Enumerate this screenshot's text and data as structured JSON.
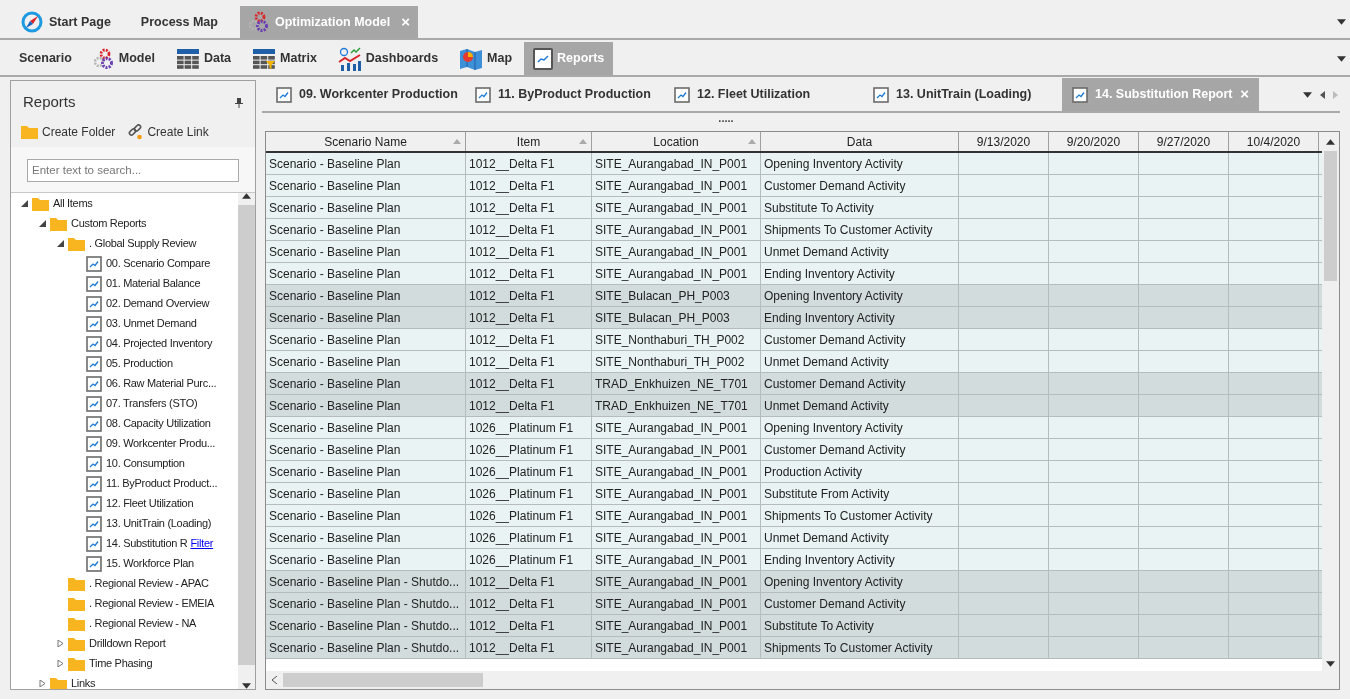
{
  "app_tabs": [
    {
      "label": "Start Page",
      "selected": false
    },
    {
      "label": "Process Map",
      "selected": false
    },
    {
      "label": "Optimization Model",
      "selected": true,
      "close": "×"
    }
  ],
  "ribbon_tabs": [
    {
      "label": "Scenario",
      "selected": false
    },
    {
      "label": "Model",
      "selected": false
    },
    {
      "label": "Data",
      "selected": false
    },
    {
      "label": "Matrix",
      "selected": false
    },
    {
      "label": "Dashboards",
      "selected": false
    },
    {
      "label": "Map",
      "selected": false
    },
    {
      "label": "Reports",
      "selected": true
    }
  ],
  "panel": {
    "title": "Reports",
    "actions": [
      "Create Folder",
      "Create Link"
    ],
    "search": {
      "placeholder": "Enter text to search..."
    },
    "tree": [
      {
        "kind": "folder",
        "label": "All Items",
        "expanded": true,
        "children": [
          {
            "kind": "folder",
            "label": "Custom Reports",
            "expanded": true,
            "children": [
              {
                "kind": "folder",
                "label": ". Global Supply Review",
                "expanded": true,
                "children": [
                  {
                    "kind": "report",
                    "label": "00. Scenario Compare"
                  },
                  {
                    "kind": "report",
                    "label": "01. Material Balance"
                  },
                  {
                    "kind": "report",
                    "label": "02. Demand Overview"
                  },
                  {
                    "kind": "report",
                    "label": "03. Unmet Demand"
                  },
                  {
                    "kind": "report",
                    "label": "04. Projected Inventory"
                  },
                  {
                    "kind": "report",
                    "label": "05. Production"
                  },
                  {
                    "kind": "report",
                    "label": "06. Raw Material Purc..."
                  },
                  {
                    "kind": "report",
                    "label": "07. Transfers (STO)"
                  },
                  {
                    "kind": "report",
                    "label": "08. Capacity Utilization"
                  },
                  {
                    "kind": "report",
                    "label": "09. Workcenter Produ..."
                  },
                  {
                    "kind": "report",
                    "label": "10. Consumption"
                  },
                  {
                    "kind": "report",
                    "label": "11. ByProduct Product..."
                  },
                  {
                    "kind": "report",
                    "label": "12. Fleet Utilization"
                  },
                  {
                    "kind": "report",
                    "label": "13. UnitTrain (Loading)"
                  },
                  {
                    "kind": "report",
                    "label": "14. Substitution R",
                    "link": "Filter"
                  },
                  {
                    "kind": "report",
                    "label": "15. Workforce Plan"
                  }
                ]
              },
              {
                "kind": "folder",
                "label": ". Regional Review - APAC"
              },
              {
                "kind": "folder",
                "label": ". Regional Review - EMEIA"
              },
              {
                "kind": "folder",
                "label": ". Regional Review - NA"
              },
              {
                "kind": "folder",
                "label": "Drilldown Report",
                "expanded": false
              },
              {
                "kind": "folder",
                "label": "Time Phasing",
                "expanded": false
              }
            ]
          },
          {
            "kind": "folder",
            "label": "Links",
            "expanded": false
          }
        ]
      }
    ]
  },
  "report_tabs": [
    {
      "label": "09. Workcenter Production",
      "selected": false
    },
    {
      "label": "11. ByProduct Production",
      "selected": false
    },
    {
      "label": "12. Fleet Utilization",
      "selected": false
    },
    {
      "label": "13. UnitTrain (Loading)",
      "selected": false
    },
    {
      "label": "14. Substitution Report",
      "selected": true,
      "close": "×"
    }
  ],
  "grid": {
    "handle": ".....",
    "columns": [
      {
        "label": "Scenario Name",
        "sort_arrow": true
      },
      {
        "label": "Item",
        "sort_arrow": true
      },
      {
        "label": "Location",
        "sort_arrow": true
      },
      {
        "label": "Data",
        "sort_arrow": false
      },
      {
        "label": "9/13/2020",
        "sort_arrow": false
      },
      {
        "label": "9/20/2020",
        "sort_arrow": false
      },
      {
        "label": "9/27/2020",
        "sort_arrow": false
      },
      {
        "label": "10/4/2020",
        "sort_arrow": false
      }
    ],
    "rows": [
      {
        "shaded": false,
        "cells": [
          "Scenario - Baseline Plan",
          "1012__Delta F1",
          "SITE_Aurangabad_IN_P001",
          "Opening Inventory Activity"
        ]
      },
      {
        "shaded": false,
        "cells": [
          "Scenario - Baseline Plan",
          "1012__Delta F1",
          "SITE_Aurangabad_IN_P001",
          "Customer Demand Activity"
        ]
      },
      {
        "shaded": false,
        "cells": [
          "Scenario - Baseline Plan",
          "1012__Delta F1",
          "SITE_Aurangabad_IN_P001",
          "Substitute To Activity"
        ]
      },
      {
        "shaded": false,
        "cells": [
          "Scenario - Baseline Plan",
          "1012__Delta F1",
          "SITE_Aurangabad_IN_P001",
          "Shipments To Customer Activity"
        ]
      },
      {
        "shaded": false,
        "cells": [
          "Scenario - Baseline Plan",
          "1012__Delta F1",
          "SITE_Aurangabad_IN_P001",
          "Unmet Demand Activity"
        ]
      },
      {
        "shaded": false,
        "cells": [
          "Scenario - Baseline Plan",
          "1012__Delta F1",
          "SITE_Aurangabad_IN_P001",
          "Ending Inventory Activity"
        ]
      },
      {
        "shaded": true,
        "cells": [
          "Scenario - Baseline Plan",
          "1012__Delta F1",
          "SITE_Bulacan_PH_P003",
          "Opening Inventory Activity"
        ]
      },
      {
        "shaded": true,
        "cells": [
          "Scenario - Baseline Plan",
          "1012__Delta F1",
          "SITE_Bulacan_PH_P003",
          "Ending Inventory Activity"
        ]
      },
      {
        "shaded": false,
        "cells": [
          "Scenario - Baseline Plan",
          "1012__Delta F1",
          "SITE_Nonthaburi_TH_P002",
          "Customer Demand Activity"
        ]
      },
      {
        "shaded": false,
        "cells": [
          "Scenario - Baseline Plan",
          "1012__Delta F1",
          "SITE_Nonthaburi_TH_P002",
          "Unmet Demand Activity"
        ]
      },
      {
        "shaded": true,
        "cells": [
          "Scenario - Baseline Plan",
          "1012__Delta F1",
          "TRAD_Enkhuizen_NE_T701",
          "Customer Demand Activity"
        ]
      },
      {
        "shaded": true,
        "cells": [
          "Scenario - Baseline Plan",
          "1012__Delta F1",
          "TRAD_Enkhuizen_NE_T701",
          "Unmet Demand Activity"
        ]
      },
      {
        "shaded": false,
        "cells": [
          "Scenario - Baseline Plan",
          "1026__Platinum F1",
          "SITE_Aurangabad_IN_P001",
          "Opening Inventory Activity"
        ]
      },
      {
        "shaded": false,
        "cells": [
          "Scenario - Baseline Plan",
          "1026__Platinum F1",
          "SITE_Aurangabad_IN_P001",
          "Customer Demand Activity"
        ]
      },
      {
        "shaded": false,
        "cells": [
          "Scenario - Baseline Plan",
          "1026__Platinum F1",
          "SITE_Aurangabad_IN_P001",
          "Production Activity"
        ]
      },
      {
        "shaded": false,
        "cells": [
          "Scenario - Baseline Plan",
          "1026__Platinum F1",
          "SITE_Aurangabad_IN_P001",
          "Substitute From Activity"
        ]
      },
      {
        "shaded": false,
        "cells": [
          "Scenario - Baseline Plan",
          "1026__Platinum F1",
          "SITE_Aurangabad_IN_P001",
          "Shipments To Customer Activity"
        ]
      },
      {
        "shaded": false,
        "cells": [
          "Scenario - Baseline Plan",
          "1026__Platinum F1",
          "SITE_Aurangabad_IN_P001",
          "Unmet Demand Activity"
        ]
      },
      {
        "shaded": false,
        "cells": [
          "Scenario - Baseline Plan",
          "1026__Platinum F1",
          "SITE_Aurangabad_IN_P001",
          "Ending Inventory Activity"
        ]
      },
      {
        "shaded": true,
        "cells": [
          "Scenario - Baseline Plan - Shutdo...",
          "1012__Delta F1",
          "SITE_Aurangabad_IN_P001",
          "Opening Inventory Activity"
        ]
      },
      {
        "shaded": true,
        "cells": [
          "Scenario - Baseline Plan - Shutdo...",
          "1012__Delta F1",
          "SITE_Aurangabad_IN_P001",
          "Customer Demand Activity"
        ]
      },
      {
        "shaded": true,
        "cells": [
          "Scenario - Baseline Plan - Shutdo...",
          "1012__Delta F1",
          "SITE_Aurangabad_IN_P001",
          "Substitute To Activity"
        ]
      },
      {
        "shaded": true,
        "cells": [
          "Scenario - Baseline Plan - Shutdo...",
          "1012__Delta F1",
          "SITE_Aurangabad_IN_P001",
          "Shipments To Customer Activity"
        ]
      }
    ]
  }
}
